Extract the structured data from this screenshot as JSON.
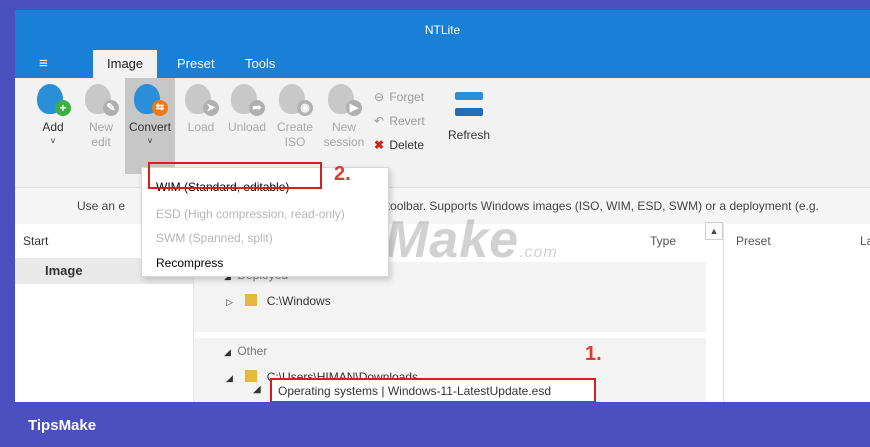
{
  "window": {
    "title": "NTLite"
  },
  "menu": {
    "hamburger": "≡",
    "tabs": [
      "Image",
      "Preset",
      "Tools"
    ]
  },
  "ribbon": {
    "add": "Add",
    "new_edit": [
      "New",
      "edit"
    ],
    "convert": "Convert",
    "load": "Load",
    "unload": "Unload",
    "create_iso": [
      "Create",
      "ISO"
    ],
    "new_session": [
      "New",
      "session"
    ],
    "forget": "Forget",
    "revert": "Revert",
    "delete": "Delete",
    "refresh": "Refresh",
    "dropdown_arrow": "˅"
  },
  "convert_menu": {
    "items": [
      {
        "label": "WIM (Standard, editable)",
        "enabled": true
      },
      {
        "label": "ESD (High compression, read-only)",
        "enabled": false
      },
      {
        "label": "SWM (Spanned, split)",
        "enabled": false
      },
      {
        "label": "Recompress",
        "enabled": true
      }
    ]
  },
  "info": {
    "left": "Use an e",
    "right": "he toolbar. Supports Windows images (ISO, WIM, ESD, SWM) or a deployment (e.g."
  },
  "nav": {
    "start_header": "Start",
    "image": "Image"
  },
  "columns": {
    "type": "Type",
    "preset": "Preset",
    "last": "Las"
  },
  "tree": {
    "deployed_group": "Deployed",
    "c_windows": "C:\\Windows",
    "other_group": "Other",
    "downloads": "C:\\Users\\HIMAN\\Downloads",
    "os_file": "Operating systems  |  Windows-11-LatestUpdate.esd"
  },
  "annotations": {
    "step1": "1.",
    "step2": "2."
  },
  "watermark": {
    "main": "TipsMake",
    "suffix": ".com"
  },
  "footer": {
    "brand": "TipsMake"
  },
  "colors": {
    "accent": "#1a7fd6",
    "frame": "#4a50c0",
    "highlight": "#d32020"
  }
}
